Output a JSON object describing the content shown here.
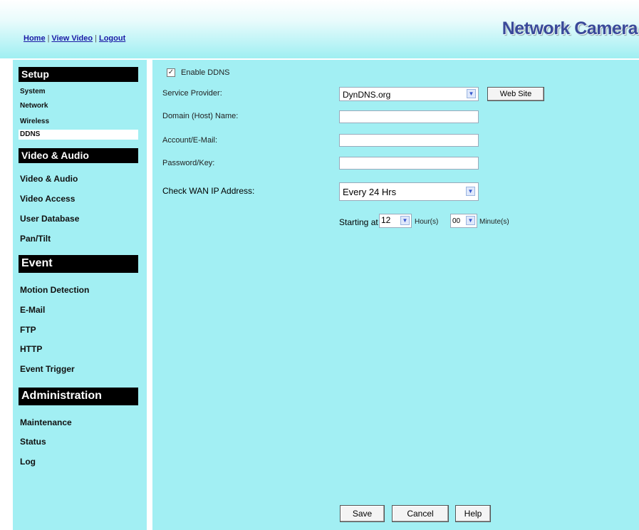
{
  "header": {
    "links": [
      "Home",
      "View Video",
      "Logout"
    ],
    "brand": "Network Camera"
  },
  "sidebar": {
    "sections": [
      {
        "title": "Setup",
        "items": [
          "System",
          "Network",
          "Wireless",
          "DDNS"
        ]
      },
      {
        "title": "Video & Audio",
        "items": [
          "Video & Audio",
          "Video Access",
          "User Database",
          "Pan/Tilt"
        ]
      },
      {
        "title": "Event",
        "items": [
          "Motion Detection",
          "E-Mail",
          "FTP",
          "HTTP",
          "Event Trigger"
        ]
      },
      {
        "title": "Administration",
        "items": [
          "Maintenance",
          "Status",
          "Log"
        ]
      }
    ],
    "active_item": "DDNS"
  },
  "form": {
    "enable_label": "Enable DDNS",
    "enable_checked": true,
    "service_provider_label": "Service Provider:",
    "service_provider_value": "DynDNS.org",
    "website_button": "Web Site",
    "domain_label": "Domain (Host) Name:",
    "domain_value": "",
    "account_label": "Account/E-Mail:",
    "account_value": "",
    "password_label": "Password/Key:",
    "password_value": "",
    "check_wan_label": "Check WAN IP Address:",
    "check_wan_value": "Every 24 Hrs",
    "starting_at_label": "Starting at",
    "hour_value": "12",
    "hour_label": "Hour(s)",
    "minute_value": "00",
    "minute_label": "Minute(s)"
  },
  "buttons": {
    "save": "Save",
    "cancel": "Cancel",
    "help": "Help"
  },
  "colors": {
    "panel_background": "#a2eff3",
    "section_header": "#000000",
    "link": "#1a1aa6",
    "brand": "#3a4a9a"
  }
}
